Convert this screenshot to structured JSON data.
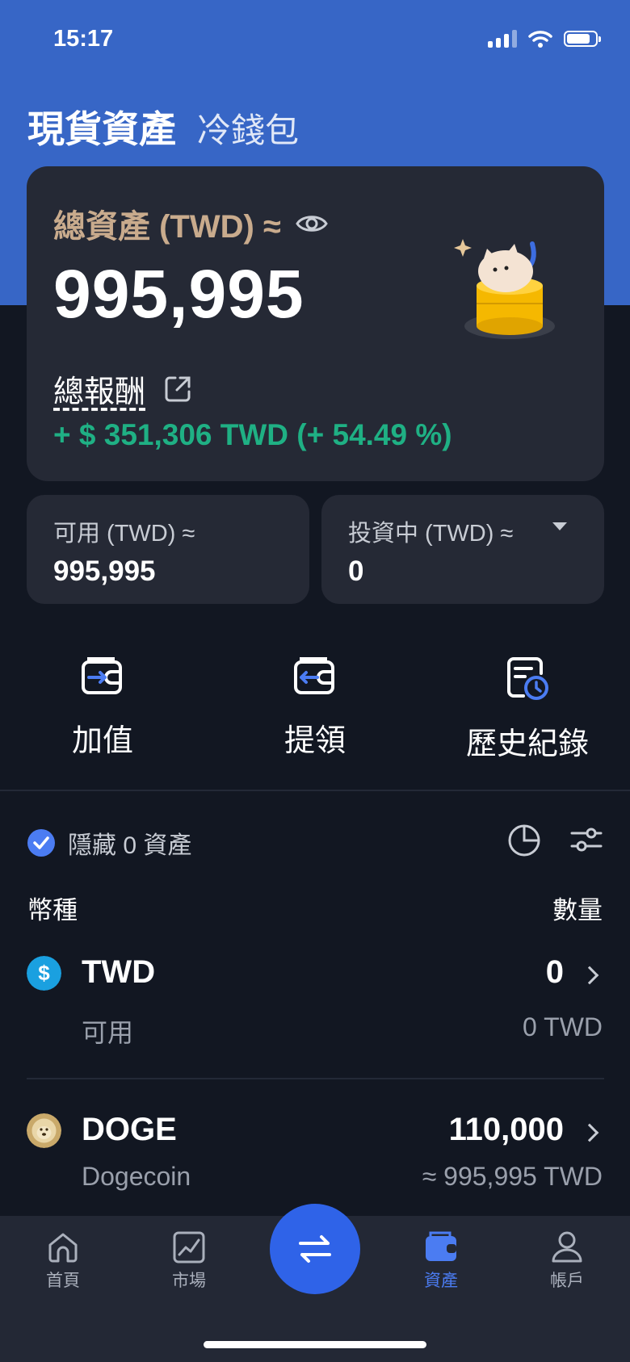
{
  "status_bar": {
    "time": "15:17"
  },
  "header": {
    "title": "現貨資產",
    "subtitle": "冷錢包"
  },
  "summary": {
    "total_label": "總資產 (TWD) ≈",
    "total_value": "995,995",
    "reward_label": "總報酬",
    "reward_value": "+ $ 351,306 TWD (+ 54.49 %)"
  },
  "available": {
    "label": "可用 (TWD) ≈",
    "value": "995,995"
  },
  "investing": {
    "label": "投資中 (TWD) ≈",
    "value": "0"
  },
  "actions": [
    {
      "label": "加值",
      "icon": "wallet-deposit-icon"
    },
    {
      "label": "提領",
      "icon": "wallet-withdraw-icon"
    },
    {
      "label": "歷史紀錄",
      "icon": "history-doc-icon"
    }
  ],
  "filter": {
    "hide_label": "隱藏 0 資產"
  },
  "columns": {
    "currency": "幣種",
    "amount": "數量"
  },
  "assets": [
    {
      "symbol": "TWD",
      "amount": "0",
      "name": "可用",
      "value": "0 TWD",
      "icon": "dollar-coin-icon",
      "icon_color": "#1aa0e0"
    },
    {
      "symbol": "DOGE",
      "amount": "110,000",
      "name": "Dogecoin",
      "value": "≈ 995,995 TWD",
      "icon": "doge-coin-icon",
      "icon_color": "#c9a96a"
    }
  ],
  "nav": [
    {
      "label": "首頁",
      "icon": "home-icon"
    },
    {
      "label": "市場",
      "icon": "market-chart-icon"
    },
    {
      "label": "資產",
      "icon": "wallet-icon",
      "active": true
    },
    {
      "label": "帳戶",
      "icon": "user-icon"
    }
  ],
  "colors": {
    "brand_blue": "#3766c6",
    "background": "#121722",
    "card": "#252935",
    "gold_label": "#c9ab8d",
    "positive": "#1fb084",
    "accent": "#4b7cf2"
  }
}
